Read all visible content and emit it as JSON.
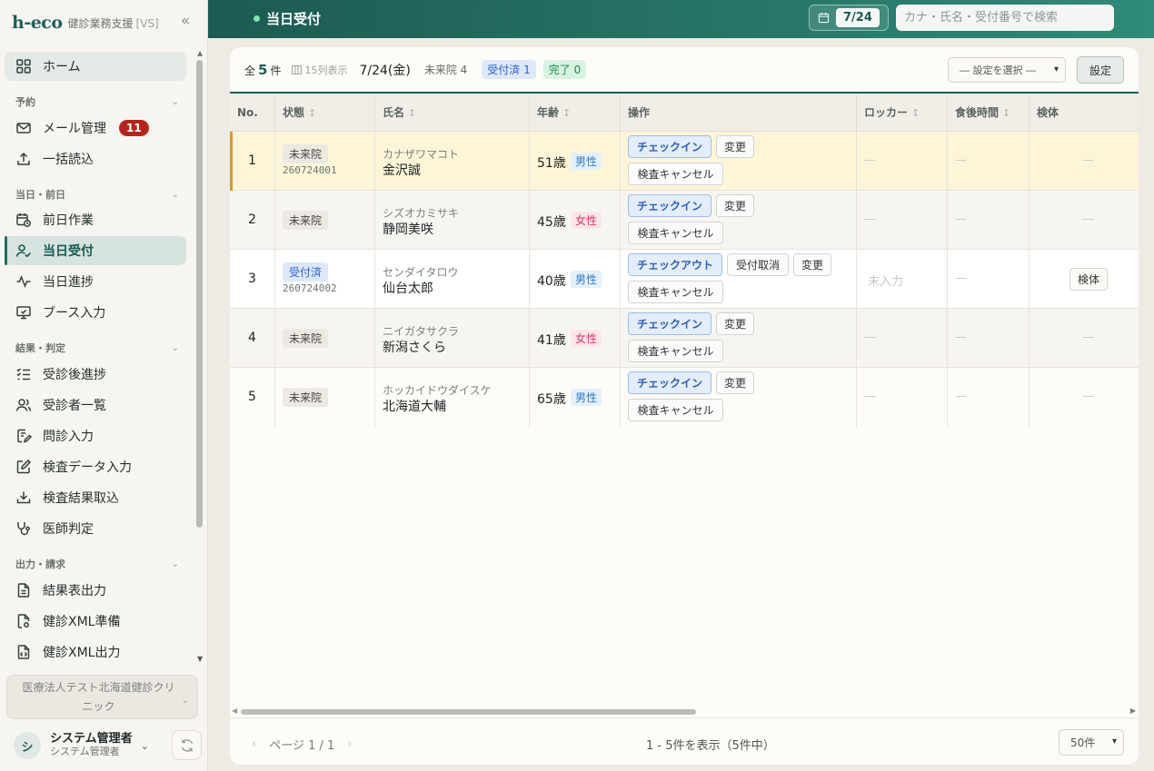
{
  "app": {
    "logo": "h-eco",
    "subtitle": "健診業務支援",
    "badge": "[VS]"
  },
  "sidebar": {
    "home": "ホーム",
    "sections": [
      {
        "label": "予約"
      },
      {
        "label": "当日・前日"
      },
      {
        "label": "結果・判定"
      },
      {
        "label": "出力・請求"
      }
    ],
    "items": [
      {
        "label": "メール管理",
        "badge": "11"
      },
      {
        "label": "一括読込"
      },
      {
        "label": "前日作業"
      },
      {
        "label": "当日受付"
      },
      {
        "label": "当日進捗"
      },
      {
        "label": "ブース入力"
      },
      {
        "label": "受診後進捗"
      },
      {
        "label": "受診者一覧"
      },
      {
        "label": "問診入力"
      },
      {
        "label": "検査データ入力"
      },
      {
        "label": "検査結果取込"
      },
      {
        "label": "医師判定"
      },
      {
        "label": "結果表出力"
      },
      {
        "label": "健診XML準備"
      },
      {
        "label": "健診XML出力"
      }
    ],
    "clinic": "医療法人テスト北海道健診クリニック",
    "user": {
      "initial": "シ",
      "name": "システム管理者",
      "role": "システム管理者"
    }
  },
  "header": {
    "title": "当日受付",
    "date": "7/24",
    "search_placeholder": "カナ・氏名・受付番号で検索"
  },
  "summary": {
    "total_prefix": "全",
    "total": "5",
    "total_suffix": "件",
    "columns": "15列表示",
    "date": "7/24(金)",
    "not_arrived": "未来院 4",
    "checked_in": "受付済 1",
    "done": "完了 0",
    "preset_placeholder": "― 設定を選択 ―",
    "settings_button": "設定"
  },
  "table": {
    "headers": {
      "no": "No.",
      "status": "状態",
      "name": "氏名",
      "age": "年齢",
      "ops": "操作",
      "locker": "ロッカー",
      "meal": "食後時間",
      "specimen": "検体"
    },
    "rows": [
      {
        "no": "1",
        "status": "未来院",
        "recno": "260724001",
        "kana": "カナザワマコト",
        "name": "金沢誠",
        "age": "51歳",
        "sex": "男性",
        "primary": "チェックイン",
        "cancel_reception": "",
        "change": "変更",
        "cancel_exam": "検査キャンセル",
        "locker": "—",
        "meal": "—",
        "specimen": "—"
      },
      {
        "no": "2",
        "status": "未来院",
        "recno": "",
        "kana": "シズオカミサキ",
        "name": "静岡美咲",
        "age": "45歳",
        "sex": "女性",
        "primary": "チェックイン",
        "cancel_reception": "",
        "change": "変更",
        "cancel_exam": "検査キャンセル",
        "locker": "—",
        "meal": "—",
        "specimen": "—"
      },
      {
        "no": "3",
        "status": "受付済",
        "recno": "260724002",
        "kana": "センダイタロウ",
        "name": "仙台太郎",
        "age": "40歳",
        "sex": "男性",
        "primary": "チェックアウト",
        "cancel_reception": "受付取消",
        "change": "変更",
        "cancel_exam": "検査キャンセル",
        "locker": "未入力",
        "meal": "—",
        "specimen": "検体"
      },
      {
        "no": "4",
        "status": "未来院",
        "recno": "",
        "kana": "ニイガタサクラ",
        "name": "新潟さくら",
        "age": "41歳",
        "sex": "女性",
        "primary": "チェックイン",
        "cancel_reception": "",
        "change": "変更",
        "cancel_exam": "検査キャンセル",
        "locker": "—",
        "meal": "—",
        "specimen": "—"
      },
      {
        "no": "5",
        "status": "未来院",
        "recno": "",
        "kana": "ホッカイドウダイスケ",
        "name": "北海道大輔",
        "age": "65歳",
        "sex": "男性",
        "primary": "チェックイン",
        "cancel_reception": "",
        "change": "変更",
        "cancel_exam": "検査キャンセル",
        "locker": "—",
        "meal": "—",
        "specimen": "—"
      }
    ]
  },
  "footer": {
    "page": "ページ 1 / 1",
    "range": "1 - 5件を表示（5件中）",
    "per_page": "50件"
  },
  "colors": {
    "brand": "#1f5e57",
    "accent_blue": "#2d62c9",
    "highlight_row": "#fdf5d8"
  }
}
